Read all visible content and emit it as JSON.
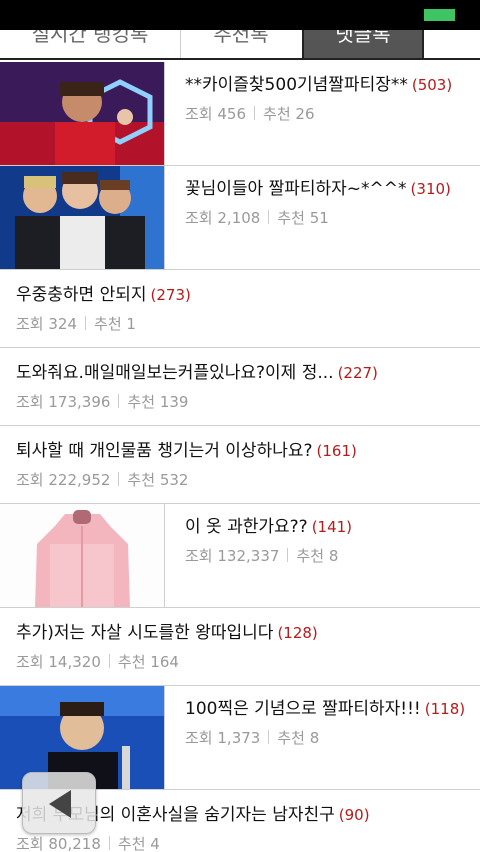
{
  "colors": {
    "accent_count": "#b51b1b",
    "battery": "#3ec463",
    "active_tab": "#555555"
  },
  "tabs": [
    {
      "label": "실시간 랭킹톡"
    },
    {
      "label": "추천톡"
    },
    {
      "label": "댓글톡"
    }
  ],
  "items": [
    {
      "title": "**카이즐찾500기념짤파티장**",
      "count": "(503)",
      "views_label": "조회",
      "views": "456",
      "rec_label": "추천",
      "rec": "26"
    },
    {
      "title": "꽃님이들아 짤파티하자~*^^*",
      "count": "(310)",
      "views_label": "조회",
      "views": "2,108",
      "rec_label": "추천",
      "rec": "51"
    },
    {
      "title": "우중충하면 안되지",
      "count": "(273)",
      "views_label": "조회",
      "views": "324",
      "rec_label": "추천",
      "rec": "1"
    },
    {
      "title": "도와줘요.매일매일보는커플있나요?이제 정...",
      "count": "(227)",
      "views_label": "조회",
      "views": "173,396",
      "rec_label": "추천",
      "rec": "139"
    },
    {
      "title": "퇴사할 때 개인물품 챙기는거 이상하나요?",
      "count": "(161)",
      "views_label": "조회",
      "views": "222,952",
      "rec_label": "추천",
      "rec": "532"
    },
    {
      "title": "이 옷 과한가요??",
      "count": "(141)",
      "views_label": "조회",
      "views": "132,337",
      "rec_label": "추천",
      "rec": "8"
    },
    {
      "title": "추가)저는 자살 시도를한 왕따입니다",
      "count": "(128)",
      "views_label": "조회",
      "views": "14,320",
      "rec_label": "추천",
      "rec": "164"
    },
    {
      "title": "100찍은 기념으로 짤파티하자!!!",
      "count": "(118)",
      "views_label": "조회",
      "views": "1,373",
      "rec_label": "추천",
      "rec": "8"
    },
    {
      "title": "저희 부모님의 이혼사실을 숨기자는 남자친구",
      "count": "(90)",
      "views_label": "조회",
      "views": "80,218",
      "rec_label": "추천",
      "rec": "4"
    }
  ]
}
